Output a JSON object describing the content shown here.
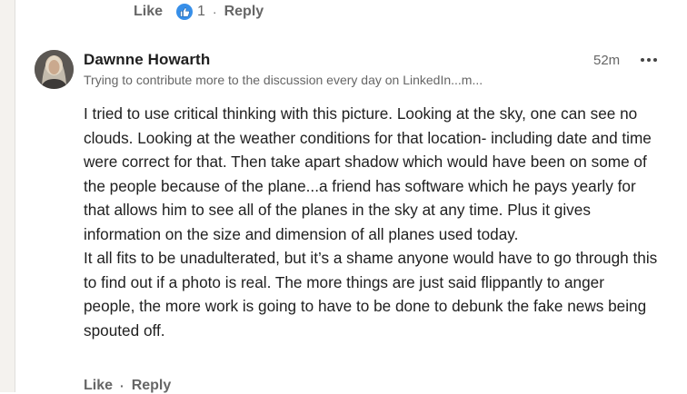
{
  "previous_comment": {
    "like_label": "Like",
    "reaction_count": "1",
    "separator": "·",
    "reply_label": "Reply"
  },
  "comment": {
    "author": "Dawnne Howarth",
    "headline": "Trying to contribute more to the discussion every day on LinkedIn...m...",
    "timestamp": "52m",
    "body": [
      "I tried to use critical thinking with this picture. Looking at the sky, one can see no clouds. Looking at the weather conditions for that location- including date and time were correct for that. Then take apart shadow which would have been on some of the people because of the plane...a friend has software which he pays yearly for that allows him to see all of the planes in the sky at any time. Plus it gives information on the size and dimension of all planes used today.",
      "It all fits to be unadulterated, but it’s a shame anyone would have to go through this to find out if a photo is real. The more things are just said flippantly to anger people, the more work is going to have to be done to debunk the fake news being spouted off."
    ],
    "actions": {
      "like_label": "Like",
      "separator": "·",
      "reply_label": "Reply"
    }
  },
  "colors": {
    "like_badge": "#378fe9",
    "muted_text": "#666666",
    "rail": "#f4f2ee"
  }
}
